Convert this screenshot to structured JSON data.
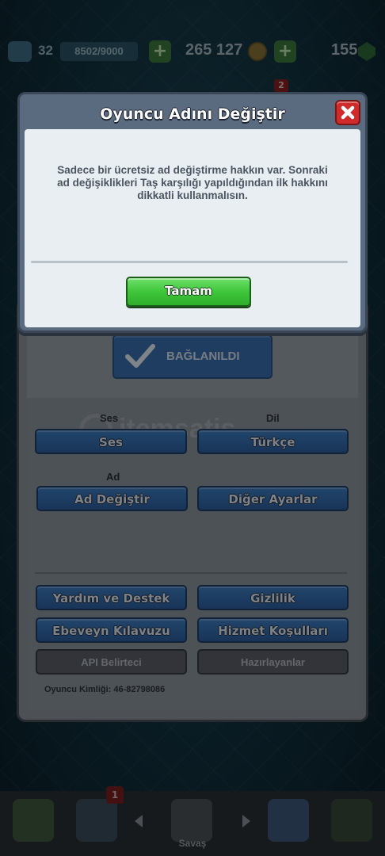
{
  "hud": {
    "level": "32",
    "xp": "8502/9000",
    "gold": "265 127",
    "gems": "155",
    "notification_count": "2"
  },
  "dialog": {
    "title": "Oyuncu Adını Değiştir",
    "message": "Sadece bir ücretsiz ad değiştirme hakkın var. Sonraki ad değişiklikleri Taş karşılığı yapıldığından ilk hakkını dikkatli kullanmalısın.",
    "ok_label": "Tamam"
  },
  "settings": {
    "connected_label": "BAĞLANILDI",
    "sound_section": "Ses",
    "sound_button": "Ses",
    "language_section": "Dil",
    "language_button": "Türkçe",
    "name_section": "Ad",
    "change_name_button": "Ad Değiştir",
    "other_settings_button": "Diğer Ayarlar",
    "help_button": "Yardım ve Destek",
    "privacy_button": "Gizlilik",
    "parent_guide_button": "Ebeveyn Kılavuzu",
    "terms_button": "Hizmet Koşulları",
    "api_button": "API Belirteci",
    "credits_button": "Hazırlayanlar",
    "player_id": "Oyuncu Kimliği: 46-82798086"
  },
  "watermark": "itemsatis",
  "bottom_nav": {
    "cards_badge": "1",
    "battle_label": "Savaş"
  },
  "colors": {
    "dialog_frame": "#5b6b7f",
    "dialog_body": "#e9eef3",
    "ok_green": "#3ec63a",
    "close_red": "#d02a2a",
    "button_blue": "#356db0",
    "button_gray": "#5b6068"
  }
}
